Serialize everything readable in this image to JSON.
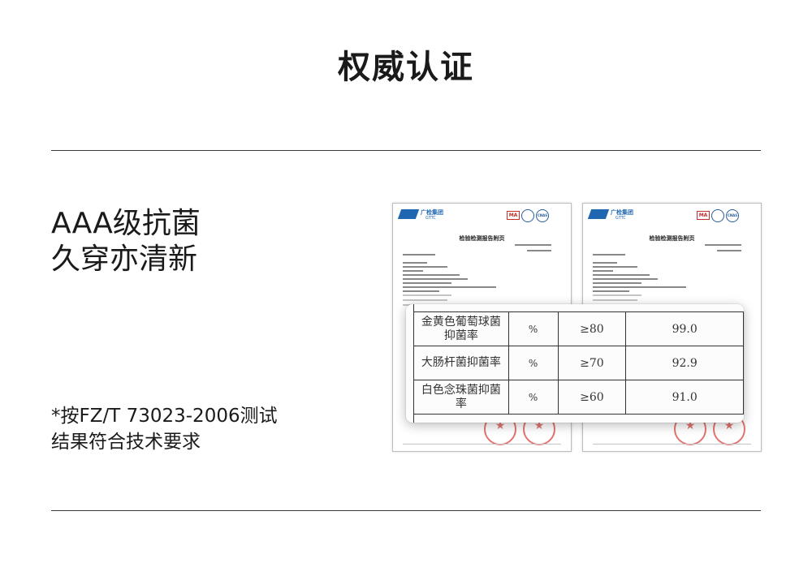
{
  "page": {
    "title": "权威认证",
    "headline_line1": "AAA级抗菌",
    "headline_line2": "久穿亦清新",
    "note_line1": "*按FZ/T 73023-2006测试",
    "note_line2": "结果符合技术要求"
  },
  "reports": [
    {
      "logo_text": "广检集团",
      "logo_sub": "GTTC",
      "title": "检验检测报告附页",
      "ma_mark": "MA",
      "cnas_mark": "CNAS"
    },
    {
      "logo_text": "广检集团",
      "logo_sub": "GTTC",
      "title": "检验检测报告附页",
      "ma_mark": "MA",
      "cnas_mark": "CNAS"
    }
  ],
  "results_table": {
    "rows": [
      {
        "item": "金黄色葡萄球菌抑菌率",
        "unit": "%",
        "requirement": "≥80",
        "result": "99.0"
      },
      {
        "item": "大肠杆菌抑菌率",
        "unit": "%",
        "requirement": "≥70",
        "result": "92.9"
      },
      {
        "item": "白色念珠菌抑菌率",
        "unit": "%",
        "requirement": "≥60",
        "result": "91.0"
      }
    ]
  },
  "colors": {
    "text": "#1a1a1a",
    "rule": "#3a3a3a",
    "stamp_red": "#d9463f",
    "gttc_blue": "#1f67b1"
  }
}
